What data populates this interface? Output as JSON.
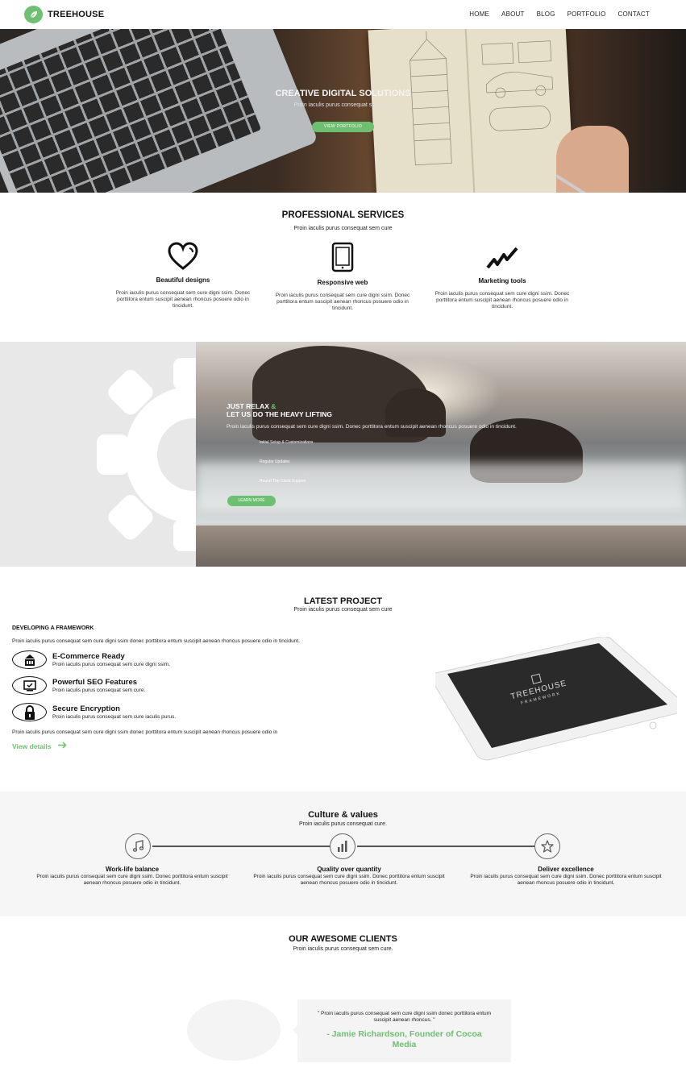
{
  "nav": {
    "brand": "TREEHOUSE",
    "items": [
      "HOME",
      "ABOUT",
      "BLOG",
      "PORTFOLIO",
      "CONTACT"
    ]
  },
  "hero": {
    "title": "CREATIVE DIGITAL SOLUTIONS",
    "subtitle": "Proin iaculis purus consequat sem cure",
    "button": "VIEW PORTFOLIO"
  },
  "services": {
    "title": "PROFESSIONAL SERVICES",
    "subtitle": "Proin iaculis purus consequat sem cure",
    "items": [
      {
        "icon": "heart-icon",
        "name": "Beautiful designs",
        "desc": "Proin iaculis purus consequat sem cure digni ssim. Donec porttitora entum suscipit aenean rhoncus posuere odio in tincidunt."
      },
      {
        "icon": "tablet-icon",
        "name": "Responsive web",
        "desc": "Proin iaculis purus consequat sem cure digni ssim. Donec porttitora entum suscipit aenean rhoncus posuere odio in tincidunt."
      },
      {
        "icon": "trend-icon",
        "name": "Marketing tools",
        "desc": "Proin iaculis purus consequat sem cure digni ssim. Donec porttitora entum suscipit aenean rhoncus posuere odio in tincidunt."
      }
    ]
  },
  "relax": {
    "title_line1": "JUST RELAX",
    "amp": "&",
    "title_line2": "LET US DO THE HEAVY LIFTING",
    "desc": "Proin iaculis purus consequat sem cure digni ssim. Donec porttitora entum suscipit aenean rhoncus posuere odio in tincidunt.",
    "list": [
      "Initial Setup & Customizations",
      "Regular Updates",
      "Round The Clock Support"
    ],
    "button": "LEARN MORE"
  },
  "project": {
    "title": "LATEST PROJECT",
    "subtitle": "Proin iaculis purus consequat sem cure",
    "heading": "DEVELOPING A FRAMEWORK",
    "intro": "Proin iaculis purus consequat sem cure digni ssim donec porttitora entum suscipit aenean rhoncus posuere odio in tincidunt.",
    "features": [
      {
        "icon": "store-icon",
        "name": "E-Commerce Ready",
        "desc": "Proin iaculis purus consequat sem cure digni ssim."
      },
      {
        "icon": "monitor-check-icon",
        "name": "Powerful SEO Features",
        "desc": "Proin iaculis purus consequat sem cure."
      },
      {
        "icon": "lock-icon",
        "name": "Secure Encryption",
        "desc": "Proin iaculis purus consequat sem cure iaculis purus."
      }
    ],
    "outro": "Proin iaculis purus consequat sem cure digni ssim donec porttitora entum suscipit aenean rhoncus posuere odio in",
    "link": "View details",
    "tablet_brand": "TREEHOUSE",
    "tablet_sub": "FRAMEWORK"
  },
  "culture": {
    "title": "Culture & values",
    "subtitle": "Proin iaculis purus consequat cure.",
    "values": [
      {
        "icon": "music-icon",
        "name": "Work-life balance",
        "desc": "Proin iaculis purus consequat sem cure digni ssim. Donec porttitora entum suscipit aenean rhoncus posuere odio in tincidunt."
      },
      {
        "icon": "bar-chart-icon",
        "name": "Quality over quantity",
        "desc": "Proin iaculis purus consequat sem cure digni ssim. Donec porttitora entum suscipit aenean rhoncus posuere odio in tincidunt."
      },
      {
        "icon": "star-icon",
        "name": "Deliver excellence",
        "desc": "Proin iaculis purus consequat sem cure digni ssim. Donec porttitora entum suscipit aenean rhoncus posuere odio in tincidunt."
      }
    ]
  },
  "clients": {
    "title": "OUR AWESOME CLIENTS",
    "subtitle": "Proin iaculis purus consequat sem cure.",
    "quote": "\" Proin iaculis purus consequat sem cure digni ssim donec porttitora entum suscipit aenean rhoncus. \"",
    "author": "- Jamie Richardson, Founder of Cocoa Media"
  },
  "colors": {
    "accent": "#6dc070",
    "section_gray": "#f6f6f6"
  }
}
